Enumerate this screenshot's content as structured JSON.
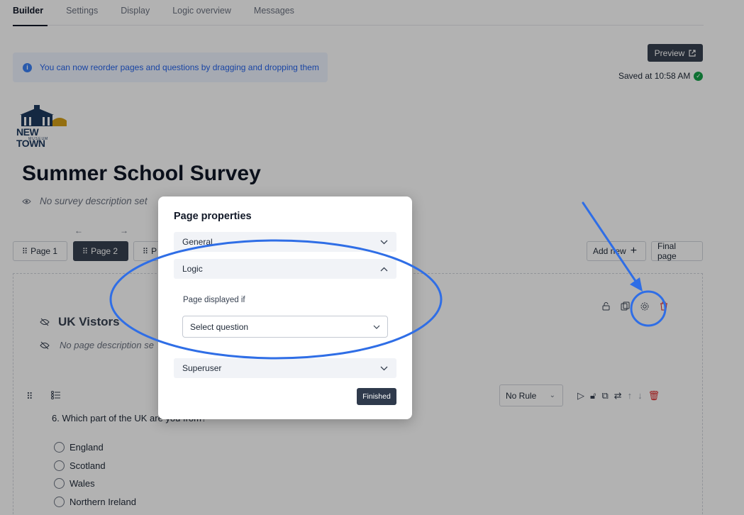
{
  "tabs": [
    "Builder",
    "Settings",
    "Display",
    "Logic overview",
    "Messages"
  ],
  "banner": {
    "text": "You can now reorder pages and questions by dragging and dropping them",
    "icon": "info-icon"
  },
  "preview": {
    "label": "Preview",
    "icon": "external-link-icon"
  },
  "saved": {
    "text": "Saved at 10:58 AM",
    "icon": "check-circle-icon"
  },
  "logo": {
    "name": "NEW TOWN",
    "sub": "MUSEUM"
  },
  "survey": {
    "title": "Summer School Survey",
    "description": "No survey description set"
  },
  "pages": {
    "page1": "Page 1",
    "page2": "Page 2",
    "page3": "P"
  },
  "page_actions": {
    "add_new": "Add new",
    "final_page": "Final page"
  },
  "page": {
    "title": "UK Vistors",
    "description": "No page description se"
  },
  "question": {
    "text": "6. Which part of the UK are you from?",
    "rule": "No Rule",
    "options": [
      "England",
      "Scotland",
      "Wales",
      "Northern Ireland"
    ]
  },
  "modal": {
    "title": "Page properties",
    "sections": {
      "general": "General",
      "logic": "Logic",
      "superuser": "Superuser"
    },
    "logic_label": "Page displayed if",
    "select_placeholder": "Select question",
    "finished": "Finished"
  },
  "colors": {
    "annotation": "#2f6ee6",
    "primary_dark": "#374151",
    "danger": "#dc2626",
    "info": "#2563eb"
  }
}
